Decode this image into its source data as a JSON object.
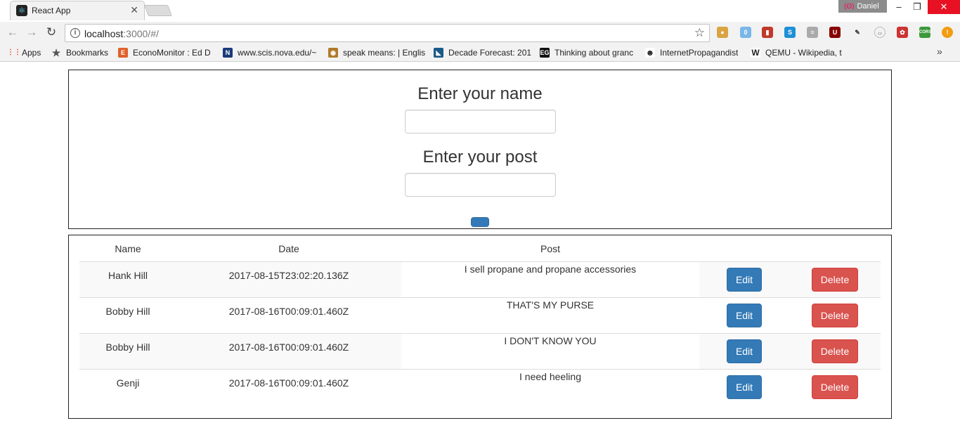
{
  "browser": {
    "tab_title": "React App",
    "profile_name": "Daniel",
    "url_host": "localhost",
    "url_rest": ":3000/#/",
    "window_controls": {
      "minimize": "–",
      "restore": "❐",
      "close": "✕"
    }
  },
  "bookmarks": {
    "items": [
      {
        "label": "Apps",
        "icon": "apps-grid-icon",
        "color": "#e0492f"
      },
      {
        "label": "Bookmarks",
        "icon": "star-icon",
        "color": "#555555"
      },
      {
        "label": "EconoMonitor : Ed D",
        "icon": "economonitor-icon",
        "color": "#e0612a"
      },
      {
        "label": "www.scis.nova.edu/~",
        "icon": "nova-icon",
        "color": "#1a3a7a"
      },
      {
        "label": "speak means: | Englis",
        "icon": "speak-icon",
        "color": "#b07a2a"
      },
      {
        "label": "Decade Forecast: 201",
        "icon": "forecast-icon",
        "color": "#1a5a8a"
      },
      {
        "label": "Thinking about granc",
        "icon": "eg-icon",
        "color": "#111111"
      },
      {
        "label": "InternetPropagandist",
        "icon": "reddit-icon",
        "color": "#ffffff"
      },
      {
        "label": "QEMU - Wikipedia, th",
        "icon": "wikipedia-icon",
        "color": "#ffffff"
      }
    ],
    "more": "»"
  },
  "form": {
    "name_heading": "Enter your name",
    "name_value": "",
    "post_heading": "Enter your post",
    "post_value": ""
  },
  "table": {
    "headers": {
      "name": "Name",
      "date": "Date",
      "post": "Post"
    },
    "rows": [
      {
        "name": "Hank Hill",
        "date": "2017-08-15T23:02:20.136Z",
        "post": "I sell propane and propane accessories",
        "edit": "Edit",
        "delete": "Delete"
      },
      {
        "name": "Bobby Hill",
        "date": "2017-08-16T00:09:01.460Z",
        "post": "THAT'S MY PURSE",
        "edit": "Edit",
        "delete": "Delete"
      },
      {
        "name": "Bobby Hill",
        "date": "2017-08-16T00:09:01.460Z",
        "post": "I DON'T KNOW YOU",
        "edit": "Edit",
        "delete": "Delete"
      },
      {
        "name": "Genji",
        "date": "2017-08-16T00:09:01.460Z",
        "post": "I need heeling",
        "edit": "Edit",
        "delete": "Delete"
      }
    ]
  },
  "colors": {
    "primary": "#337ab7",
    "danger": "#d9534f",
    "stripe": "#f9f9f9"
  }
}
